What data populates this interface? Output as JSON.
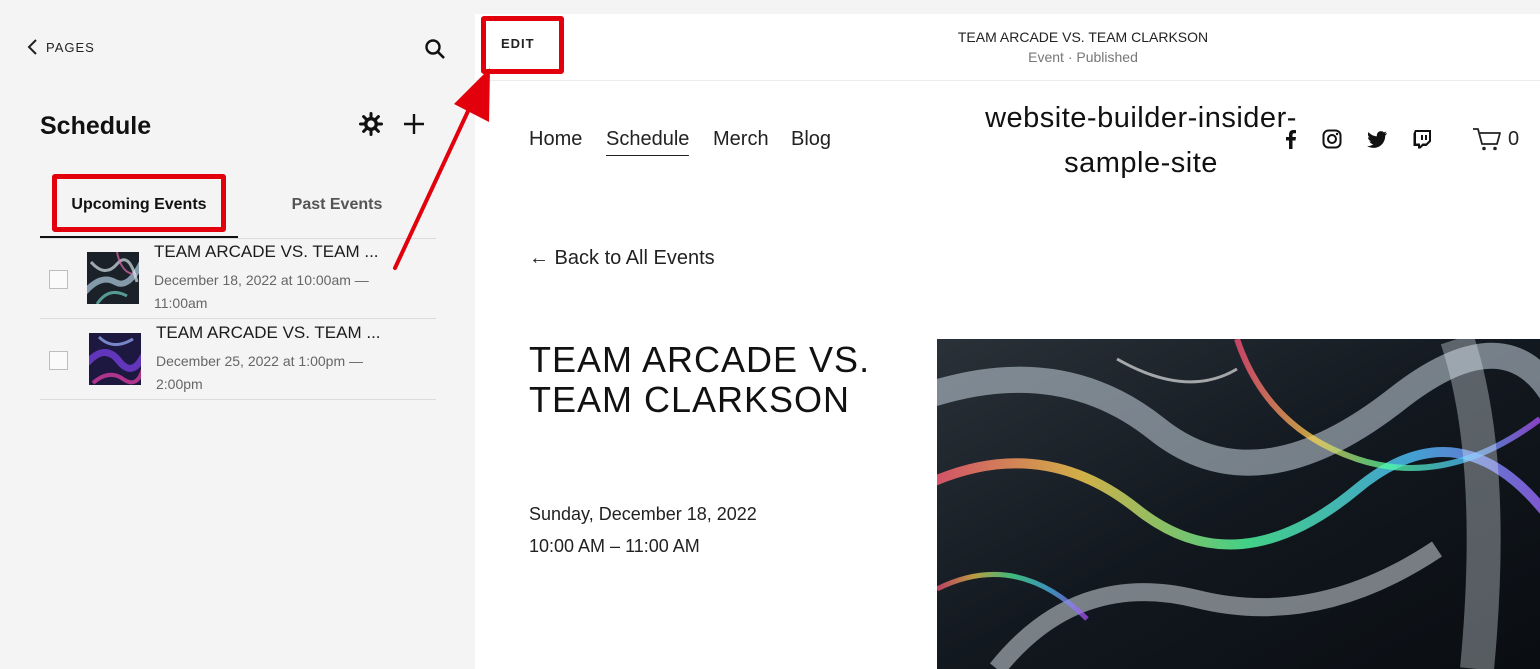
{
  "sidebar": {
    "back_label": "PAGES",
    "title": "Schedule",
    "tabs": [
      {
        "label": "Upcoming Events",
        "active": true
      },
      {
        "label": "Past Events",
        "active": false
      }
    ],
    "events": [
      {
        "title": "TEAM ARCADE VS. TEAM ...",
        "date": "December 18, 2022 at 10:00am — 11:00am"
      },
      {
        "title": "TEAM ARCADE VS. TEAM ...",
        "date": "December 25, 2022 at 1:00pm — 2:00pm"
      }
    ]
  },
  "preview": {
    "edit_label": "EDIT",
    "doc_title": "TEAM ARCADE VS. TEAM CLARKSON",
    "doc_status": "Event · Published",
    "nav": [
      "Home",
      "Schedule",
      "Merch",
      "Blog"
    ],
    "site_title": "website-builder-insider-sample-site",
    "cart_count": "0",
    "back_link": "← Back to All Events",
    "event_heading": "TEAM ARCADE VS. TEAM CLARKSON",
    "event_date": "Sunday, December 18, 2022",
    "event_time": "10:00 AM – 11:00 AM"
  },
  "colors": {
    "highlight": "#e1000b",
    "sidebar_bg": "#f4f4f4",
    "preview_bg": "#ffffff"
  },
  "icons": [
    "chevron-left-icon",
    "search-icon",
    "gear-icon",
    "plus-icon",
    "facebook-icon",
    "instagram-icon",
    "twitter-icon",
    "twitch-icon",
    "cart-icon",
    "arrow-annotation"
  ]
}
